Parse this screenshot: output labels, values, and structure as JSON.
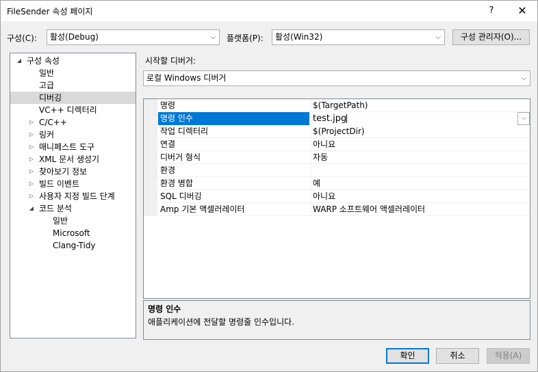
{
  "window": {
    "title": "FileSender 속성 페이지",
    "help_glyph": "?",
    "close_glyph": "✕"
  },
  "toolbar": {
    "config_label": "구성(C):",
    "config_value": "활성(Debug)",
    "platform_label": "플랫폼(P):",
    "platform_value": "활성(Win32)",
    "config_manager_label": "구성 관리자(O)..."
  },
  "tree": {
    "items": [
      {
        "label": "구성 속성",
        "level": 0,
        "expander": "◢",
        "selected": false
      },
      {
        "label": "일반",
        "level": 1,
        "expander": "",
        "selected": false
      },
      {
        "label": "고급",
        "level": 1,
        "expander": "",
        "selected": false
      },
      {
        "label": "디버깅",
        "level": 1,
        "expander": "",
        "selected": true
      },
      {
        "label": "VC++ 디렉터리",
        "level": 1,
        "expander": "",
        "selected": false
      },
      {
        "label": "C/C++",
        "level": 1,
        "expander": "▷",
        "selected": false
      },
      {
        "label": "링커",
        "level": 1,
        "expander": "▷",
        "selected": false
      },
      {
        "label": "매니페스트 도구",
        "level": 1,
        "expander": "▷",
        "selected": false
      },
      {
        "label": "XML 문서 생성기",
        "level": 1,
        "expander": "▷",
        "selected": false
      },
      {
        "label": "찾아보기 정보",
        "level": 1,
        "expander": "▷",
        "selected": false
      },
      {
        "label": "빌드 이벤트",
        "level": 1,
        "expander": "▷",
        "selected": false
      },
      {
        "label": "사용자 지정 빌드 단계",
        "level": 1,
        "expander": "▷",
        "selected": false
      },
      {
        "label": "코드 분석",
        "level": 1,
        "expander": "◢",
        "selected": false
      },
      {
        "label": "일반",
        "level": 2,
        "expander": "",
        "selected": false
      },
      {
        "label": "Microsoft",
        "level": 2,
        "expander": "",
        "selected": false
      },
      {
        "label": "Clang-Tidy",
        "level": 2,
        "expander": "",
        "selected": false
      }
    ]
  },
  "debugger": {
    "label": "시작할 디버거:",
    "value": "로컬 Windows 디버거"
  },
  "grid": {
    "rows": [
      {
        "name": "명령",
        "value": "$(TargetPath)",
        "selected": false
      },
      {
        "name": "명령 인수",
        "value": "test.jpg",
        "selected": true
      },
      {
        "name": "작업 디렉터리",
        "value": "$(ProjectDir)",
        "selected": false
      },
      {
        "name": "연결",
        "value": "아니요",
        "selected": false
      },
      {
        "name": "디버거 형식",
        "value": "자동",
        "selected": false
      },
      {
        "name": "환경",
        "value": "",
        "selected": false
      },
      {
        "name": "환경 병합",
        "value": "예",
        "selected": false
      },
      {
        "name": "SQL 디버깅",
        "value": "아니요",
        "selected": false
      },
      {
        "name": "Amp 기본 액셀러레이터",
        "value": "WARP 소프트웨어 액셀러레이터",
        "selected": false
      }
    ]
  },
  "description": {
    "title": "명령 인수",
    "text": "애플리케이션에 전달할 명령줄 인수입니다."
  },
  "buttons": {
    "ok": "확인",
    "cancel": "취소",
    "apply": "적용(A)"
  },
  "icons": {
    "dropdown": "chevron-down-icon",
    "dropdown_glyph": "⌵"
  }
}
